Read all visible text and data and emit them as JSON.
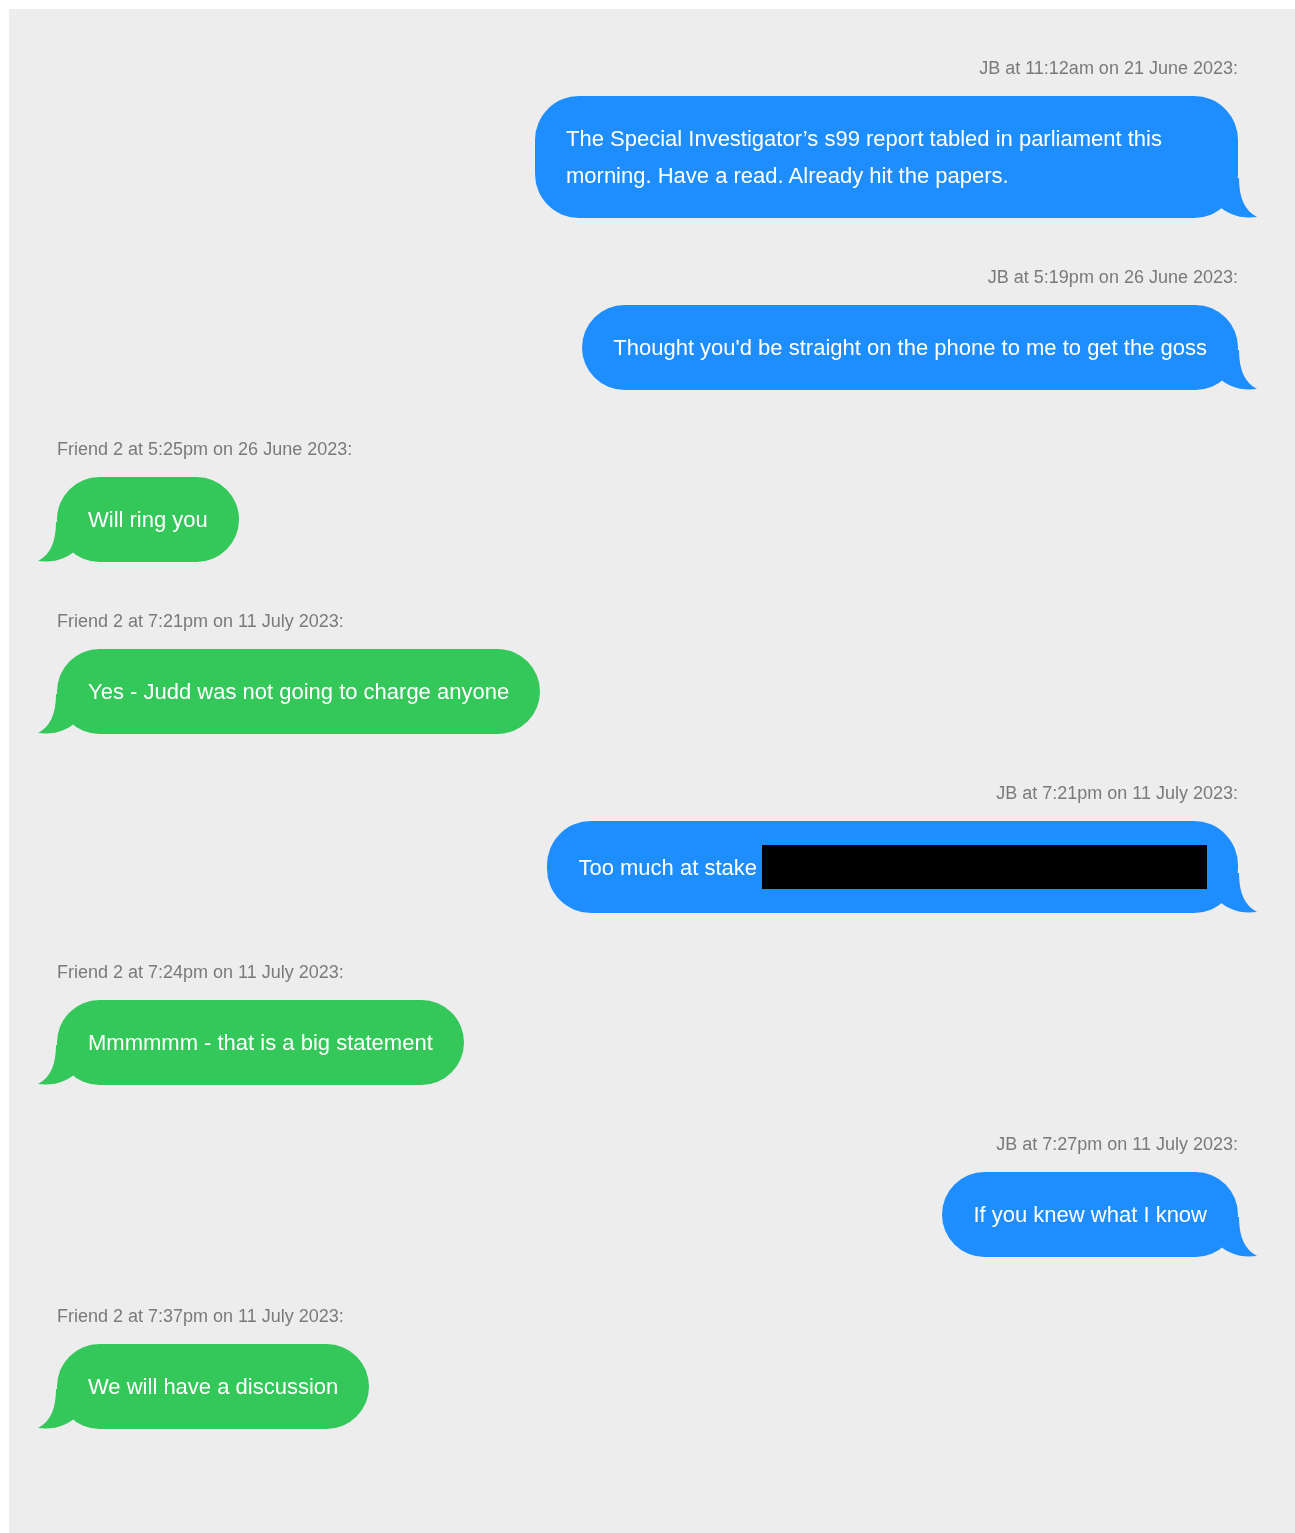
{
  "messages": [
    {
      "kind": "sent",
      "sender": "JB at 11:12am on 21 June 2023:",
      "text": "The Special Investigator’s s99 report tabled in parliament this morning. Have a read. Already hit the papers.",
      "redacted": false
    },
    {
      "kind": "sent",
      "sender": "JB at 5:19pm on 26 June 2023:",
      "text": "Thought you'd be straight on the phone to me to get the goss",
      "redacted": false
    },
    {
      "kind": "received",
      "sender": "Friend 2 at 5:25pm on 26 June 2023:",
      "text": "Will ring you",
      "redacted": false
    },
    {
      "kind": "received",
      "sender": "Friend 2 at 7:21pm on 11 July 2023:",
      "text": "Yes - Judd was not going to charge anyone",
      "redacted": false
    },
    {
      "kind": "sent",
      "sender": "JB at 7:21pm on 11 July 2023:",
      "text": "Too much at stake",
      "redacted": true
    },
    {
      "kind": "received",
      "sender": "Friend 2 at 7:24pm on 11 July 2023:",
      "text": "Mmmmmm - that is a big statement",
      "redacted": false
    },
    {
      "kind": "sent",
      "sender": "JB at 7:27pm on 11 July 2023:",
      "text": "If you knew what I know",
      "redacted": false
    },
    {
      "kind": "received",
      "sender": "Friend 2 at 7:37pm on 11 July 2023:",
      "text": "We will have a discussion",
      "redacted": false
    }
  ]
}
